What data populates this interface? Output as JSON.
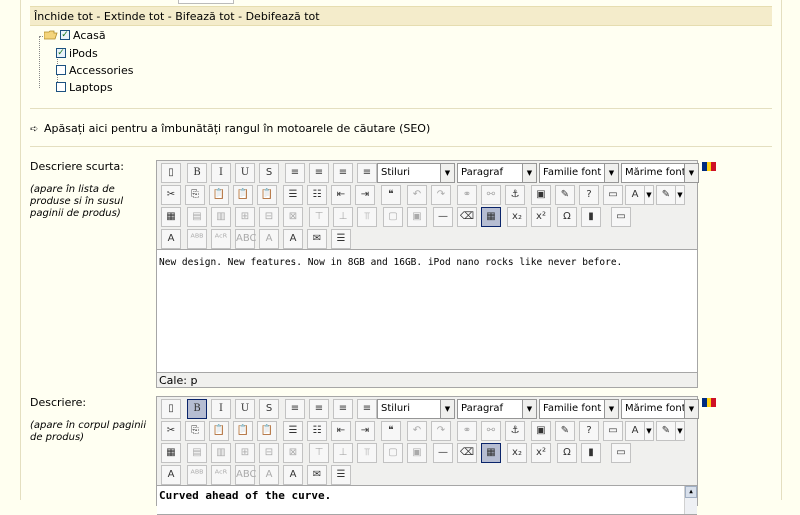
{
  "tree": {
    "toolbar": [
      {
        "label": "Închide tot"
      },
      {
        "label": "Extinde tot"
      },
      {
        "label": "Bifează tot"
      },
      {
        "label": "Debifează tot"
      }
    ],
    "separator": " - ",
    "root": {
      "label": "Acasă",
      "checked": true
    },
    "children": [
      {
        "label": "iPods",
        "checked": true
      },
      {
        "label": "Accessories",
        "checked": false
      },
      {
        "label": "Laptops",
        "checked": false
      }
    ]
  },
  "seo_link": "Apăsați aici pentru a îmbunătăți rangul în motoarele de căutare (SEO)",
  "short_desc": {
    "label": "Descriere scurta:",
    "hint": "(apare în lista de produse si în susul paginii de produs)",
    "content": "New design. New features. Now in 8GB and 16GB. iPod nano rocks like never before.",
    "path": "Cale: p"
  },
  "description": {
    "label": "Descriere:",
    "hint": "(apare în corpul paginii de produs)",
    "content": "Curved ahead of the curve."
  },
  "editor_selects": {
    "styles": "Stiluri",
    "format": "Paragraf",
    "font_family": "Familie font",
    "font_size": "Mărime font"
  },
  "buttons_row1": [
    {
      "name": "new-document",
      "glyph": "▯"
    },
    {
      "name": "bold",
      "glyph": "B"
    },
    {
      "name": "italic",
      "glyph": "I"
    },
    {
      "name": "underline",
      "glyph": "U"
    },
    {
      "name": "strikethrough",
      "glyph": "S"
    },
    {
      "name": "align-left",
      "glyph": "≡"
    },
    {
      "name": "align-center",
      "glyph": "≡"
    },
    {
      "name": "align-right",
      "glyph": "≡"
    },
    {
      "name": "align-justify",
      "glyph": "≡"
    }
  ],
  "buttons_row2": [
    {
      "name": "cut",
      "glyph": "✂"
    },
    {
      "name": "copy",
      "glyph": "⎘"
    },
    {
      "name": "paste",
      "glyph": "📋"
    },
    {
      "name": "paste-text",
      "glyph": "📋"
    },
    {
      "name": "paste-word",
      "glyph": "📋"
    },
    {
      "name": "unordered-list",
      "glyph": "☰"
    },
    {
      "name": "ordered-list",
      "glyph": "☷"
    },
    {
      "name": "outdent",
      "glyph": "⇤"
    },
    {
      "name": "indent",
      "glyph": "⇥"
    },
    {
      "name": "blockquote",
      "glyph": "❝"
    },
    {
      "name": "undo",
      "glyph": "↶"
    },
    {
      "name": "redo",
      "glyph": "↷"
    },
    {
      "name": "link",
      "glyph": "⚭"
    },
    {
      "name": "unlink",
      "glyph": "⚯"
    },
    {
      "name": "anchor",
      "glyph": "⚓"
    },
    {
      "name": "image",
      "glyph": "▣"
    },
    {
      "name": "cleanup",
      "glyph": "✎"
    },
    {
      "name": "help",
      "glyph": "?"
    },
    {
      "name": "html",
      "glyph": "▭"
    },
    {
      "name": "text-color",
      "glyph": "A"
    },
    {
      "name": "highlight-color",
      "glyph": "✎"
    }
  ],
  "buttons_row3": [
    {
      "name": "table-edit",
      "glyph": "▦"
    },
    {
      "name": "table-row-props",
      "glyph": "▤"
    },
    {
      "name": "table-cell-props",
      "glyph": "▥"
    },
    {
      "name": "row-before",
      "glyph": "⊞"
    },
    {
      "name": "row-after",
      "glyph": "⊟"
    },
    {
      "name": "delete-row",
      "glyph": "⊠"
    },
    {
      "name": "col-before",
      "glyph": "⊤"
    },
    {
      "name": "col-after",
      "glyph": "⊥"
    },
    {
      "name": "delete-col",
      "glyph": "⫪"
    },
    {
      "name": "split-cells",
      "glyph": "▢"
    },
    {
      "name": "merge-cells",
      "glyph": "▣"
    },
    {
      "name": "horizontal-rule",
      "glyph": "—"
    },
    {
      "name": "remove-format",
      "glyph": "⌫"
    },
    {
      "name": "visual-aid",
      "glyph": "▦"
    },
    {
      "name": "subscript",
      "glyph": "x₂"
    },
    {
      "name": "superscript",
      "glyph": "x²"
    },
    {
      "name": "special-char",
      "glyph": "Ω"
    },
    {
      "name": "media",
      "glyph": "▮"
    },
    {
      "name": "preview",
      "glyph": "▭"
    }
  ],
  "buttons_row4": [
    {
      "name": "spellcheck",
      "glyph": "A"
    },
    {
      "name": "abbr",
      "glyph": "ᴬᴮᴮ"
    },
    {
      "name": "acronym",
      "glyph": "ᴬᶜᴿ"
    },
    {
      "name": "abc",
      "glyph": "ABC"
    },
    {
      "name": "strike-a",
      "glyph": "A"
    },
    {
      "name": "font-a",
      "glyph": "A"
    },
    {
      "name": "template",
      "glyph": "✉"
    },
    {
      "name": "pagebreak",
      "glyph": "☰"
    }
  ],
  "colors": {
    "flag_blue": "#002b7f",
    "flag_yellow": "#fcd116",
    "flag_red": "#ce1126"
  }
}
